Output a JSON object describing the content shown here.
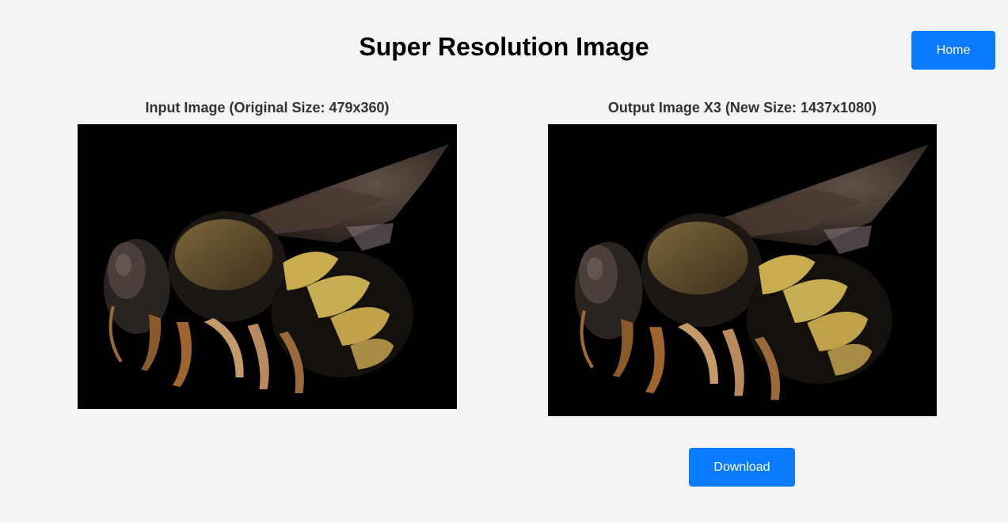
{
  "page": {
    "title": "Super Resolution Image"
  },
  "nav": {
    "home_label": "Home"
  },
  "input_panel": {
    "caption": "Input Image (Original Size: 479x360)",
    "image_subject": "bee-macro-photo"
  },
  "output_panel": {
    "caption": "Output Image X3 (New Size: 1437x1080)",
    "image_subject": "bee-macro-photo",
    "download_label": "Download"
  },
  "colors": {
    "background": "#f4f4f4",
    "button": "#0a7bff",
    "button_text": "#ffffff",
    "caption_text": "#333333",
    "image_background": "#000000"
  }
}
